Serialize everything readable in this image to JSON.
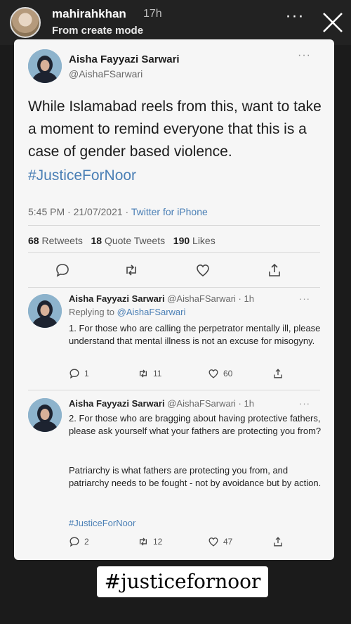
{
  "story": {
    "username": "mahirahkhan",
    "time": "17h",
    "mode": "From create mode",
    "more_icon": "ellipsis-icon",
    "close_icon": "close-icon"
  },
  "tweet": {
    "author_name": "Aisha Fayyazi Sarwari",
    "author_handle": "@AishaFSarwari",
    "more": "···",
    "text": "While Islamabad reels from this, want to take a moment to remind everyone that this is a case of gender based violence.",
    "hashtag": "#JusticeForNoor",
    "time": "5:45 PM · 21/07/2021 · ",
    "source": "Twitter for iPhone",
    "stats": {
      "retweets_count": "68",
      "retweets_label": "Retweets",
      "quotes_count": "18",
      "quotes_label": "Quote Tweets",
      "likes_count": "190",
      "likes_label": "Likes"
    }
  },
  "replies": [
    {
      "author_name": "Aisha Fayyazi Sarwari",
      "meta": "@AishaFSarwari · 1h",
      "replying_prefix": "Replying to ",
      "replying_to": "@AishaFSarwari",
      "text": "1. For those who are calling the perpetrator mentally ill, please understand that mental illness is not an excuse for misogyny.",
      "replies": "1",
      "retweets": "11",
      "likes": "60"
    },
    {
      "author_name": "Aisha Fayyazi Sarwari",
      "meta": "@AishaFSarwari · 1h",
      "text": "2. For those who are bragging about having protective fathers, please ask yourself what your fathers are protecting you from?",
      "text2": "Patriarchy is what fathers are protecting you from, and patriarchy needs to be fought - not by avoidance but by action.",
      "hashtag": "#JusticeForNoor",
      "replies": "2",
      "retweets": "12",
      "likes": "47"
    }
  ],
  "sticker": {
    "text": "#justicefornoor"
  }
}
